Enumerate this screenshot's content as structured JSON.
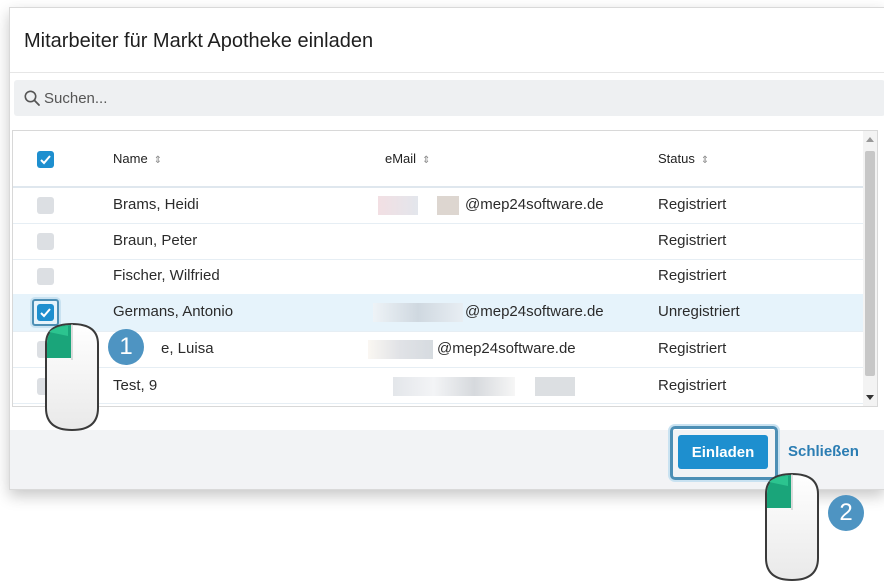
{
  "dialog": {
    "title": "Mitarbeiter für Markt Apotheke einladen",
    "search_placeholder": "Suchen..."
  },
  "table": {
    "headers": {
      "name": "Name",
      "email": "eMail",
      "status": "Status"
    },
    "rows": [
      {
        "name": "Brams, Heidi",
        "email": "@mep24software.de",
        "status": "Registriert",
        "checked": false
      },
      {
        "name": "Braun, Peter",
        "email": "",
        "status": "Registriert",
        "checked": false
      },
      {
        "name": "Fischer, Wilfried",
        "email": "",
        "status": "Registriert",
        "checked": false
      },
      {
        "name": "Germans, Antonio",
        "email": "@mep24software.de",
        "status": "Unregistriert",
        "checked": true
      },
      {
        "name": "e, Luisa",
        "email": "@mep24software.de",
        "status": "Registriert",
        "checked": false
      },
      {
        "name": "Test, 9",
        "email": "",
        "status": "Registriert",
        "checked": false
      }
    ]
  },
  "footer": {
    "invite_label": "Einladen",
    "close_label": "Schließen"
  },
  "annotations": {
    "step1": "1",
    "step2": "2"
  },
  "colors": {
    "accent": "#1e8fcf",
    "badge": "#4e94c2",
    "selected_row": "#e6f3fb",
    "mouse_button": "#1aa57a"
  }
}
